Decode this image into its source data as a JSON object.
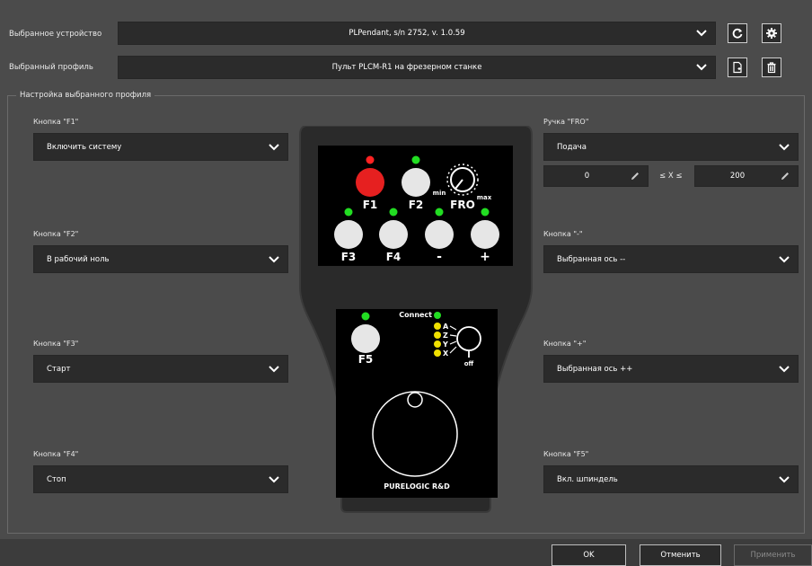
{
  "device_row": {
    "label": "Выбранное устройство",
    "value": "PLPendant, s/n 2752, v. 1.0.59"
  },
  "profile_row": {
    "label": "Выбранный профиль",
    "value": "Пульт PLCM-R1 на фрезерном станке"
  },
  "settings_group": {
    "title": "Настройка выбранного профиля"
  },
  "left": {
    "f1": {
      "label": "Кнопка \"F1\"",
      "value": "Включить систему"
    },
    "f2": {
      "label": "Кнопка \"F2\"",
      "value": "В рабочий ноль"
    },
    "f3": {
      "label": "Кнопка \"F3\"",
      "value": "Старт"
    },
    "f4": {
      "label": "Кнопка \"F4\"",
      "value": "Стоп"
    }
  },
  "right": {
    "fro": {
      "label": "Ручка \"FRO\"",
      "value": "Подача",
      "min": "0",
      "max": "200",
      "range_label": "≤ X ≤"
    },
    "minus": {
      "label": "Кнопка \"-\"",
      "value": "Выбранная ось --"
    },
    "plus": {
      "label": "Кнопка \"+\"",
      "value": "Выбранная ось ++"
    },
    "f5": {
      "label": "Кнопка \"F5\"",
      "value": "Вкл. шпиндель"
    }
  },
  "pendant": {
    "btn_f1": "F1",
    "btn_f2": "F2",
    "btn_f3": "F3",
    "btn_f4": "F4",
    "btn_minus": "-",
    "btn_plus": "+",
    "btn_f5": "F5",
    "fro_label": "FRO",
    "fro_min": "min",
    "fro_max": "max",
    "connect": "Connect",
    "axis_a": "A",
    "axis_z": "Z",
    "axis_y": "Y",
    "axis_x": "X",
    "axis_off": "off",
    "brand": "PURELOGIC R&D",
    "colors": {
      "led_on": "#22dd22",
      "led_red": "#ff2222",
      "led_yellow": "#f0e000",
      "f1_button": "#e62020"
    }
  },
  "footer": {
    "ok": "OK",
    "cancel": "Отменить",
    "apply": "Применить"
  }
}
